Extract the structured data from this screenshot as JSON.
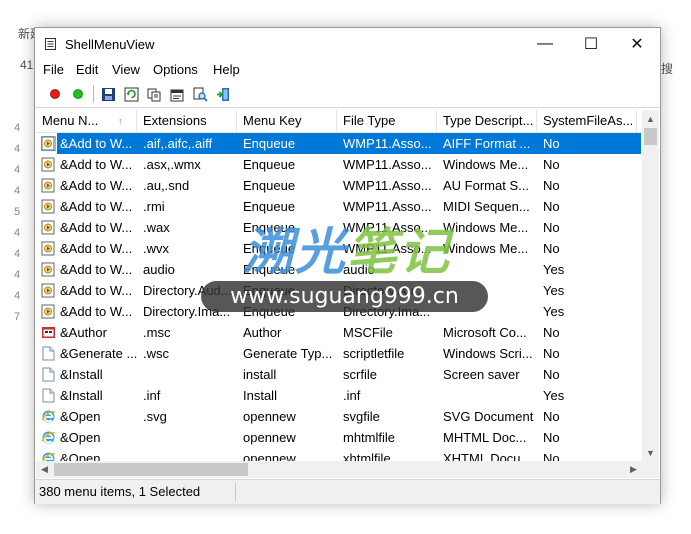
{
  "background": {
    "top_text": "新建",
    "top_number": "41",
    "right_text": "搜",
    "left_numbers": [
      "4",
      "4",
      "4",
      "4",
      "5",
      "4",
      "4",
      "4",
      "4",
      "7"
    ]
  },
  "window": {
    "title": "ShellMenuView",
    "controls": {
      "minimize": "—",
      "maximize": "☐",
      "close": "✕"
    }
  },
  "menu": [
    "File",
    "Edit",
    "View",
    "Options",
    "Help"
  ],
  "toolbar": {
    "buttons": [
      "red-dot-icon",
      "green-dot-icon",
      "save-icon",
      "refresh-icon",
      "copy-icon",
      "properties-icon",
      "find-icon",
      "exit-icon"
    ]
  },
  "columns": [
    "Menu N...",
    "Extensions",
    "Menu Key",
    "File Type",
    "Type Descript...",
    "SystemFileAs..."
  ],
  "sort_indicator": "↑",
  "rows": [
    {
      "name": "&Add to W...",
      "ext": ".aif,.aifc,.aiff",
      "key": "Enqueue",
      "ftype": "WMP11.Asso...",
      "desc": "AIFF Format ...",
      "sys": "No",
      "icon": "menu-item-icon",
      "selected": true
    },
    {
      "name": "&Add to W...",
      "ext": ".asx,.wmx",
      "key": "Enqueue",
      "ftype": "WMP11.Asso...",
      "desc": "Windows Me...",
      "sys": "No",
      "icon": "menu-item-icon"
    },
    {
      "name": "&Add to W...",
      "ext": ".au,.snd",
      "key": "Enqueue",
      "ftype": "WMP11.Asso...",
      "desc": "AU Format S...",
      "sys": "No",
      "icon": "menu-item-icon"
    },
    {
      "name": "&Add to W...",
      "ext": ".rmi",
      "key": "Enqueue",
      "ftype": "WMP11.Asso...",
      "desc": "MIDI Sequen...",
      "sys": "No",
      "icon": "menu-item-icon"
    },
    {
      "name": "&Add to W...",
      "ext": ".wax",
      "key": "Enqueue",
      "ftype": "WMP11.Asso...",
      "desc": "Windows Me...",
      "sys": "No",
      "icon": "menu-item-icon"
    },
    {
      "name": "&Add to W...",
      "ext": ".wvx",
      "key": "Enqueue",
      "ftype": "WMP11.Asso...",
      "desc": "Windows Me...",
      "sys": "No",
      "icon": "menu-item-icon"
    },
    {
      "name": "&Add to W...",
      "ext": "audio",
      "key": "Enqueue",
      "ftype": "audio",
      "desc": "",
      "sys": "Yes",
      "icon": "menu-item-icon"
    },
    {
      "name": "&Add to W...",
      "ext": "Directory.Aud...",
      "key": "Enqueue",
      "ftype": "Directory.Au...",
      "desc": "",
      "sys": "Yes",
      "icon": "menu-item-icon"
    },
    {
      "name": "&Add to W...",
      "ext": "Directory.Ima...",
      "key": "Enqueue",
      "ftype": "Directory.Ima...",
      "desc": "",
      "sys": "Yes",
      "icon": "menu-item-icon"
    },
    {
      "name": "&Author",
      "ext": ".msc",
      "key": "Author",
      "ftype": "MSCFile",
      "desc": "Microsoft Co...",
      "sys": "No",
      "icon": "mmc-icon"
    },
    {
      "name": "&Generate ...",
      "ext": ".wsc",
      "key": "Generate Typ...",
      "ftype": "scriptletfile",
      "desc": "Windows Scri...",
      "sys": "No",
      "icon": "document-icon"
    },
    {
      "name": "&Install",
      "ext": "",
      "key": "install",
      "ftype": "scrfile",
      "desc": "Screen saver",
      "sys": "No",
      "icon": "document-icon"
    },
    {
      "name": "&Install",
      "ext": ".inf",
      "key": "Install",
      "ftype": ".inf",
      "desc": "",
      "sys": "Yes",
      "icon": "document-icon"
    },
    {
      "name": "&Open",
      "ext": ".svg",
      "key": "opennew",
      "ftype": "svgfile",
      "desc": "SVG Document",
      "sys": "No",
      "icon": "ie-icon"
    },
    {
      "name": "&Open",
      "ext": "",
      "key": "opennew",
      "ftype": "mhtmlfile",
      "desc": "MHTML Doc...",
      "sys": "No",
      "icon": "ie-icon"
    },
    {
      "name": "&Open",
      "ext": "",
      "key": "opennew",
      "ftype": "xhtmlfile",
      "desc": "XHTML Docu...",
      "sys": "No",
      "icon": "ie-icon"
    }
  ],
  "status": "380 menu items, 1 Selected",
  "watermark": {
    "cn_blue": "溯光",
    "cn_green": "笔记",
    "url": "www.suguang999.cn"
  },
  "colors": {
    "selection": "#0078d7",
    "watermark_blue": "#3c8fd9",
    "watermark_green": "#7fc341"
  }
}
